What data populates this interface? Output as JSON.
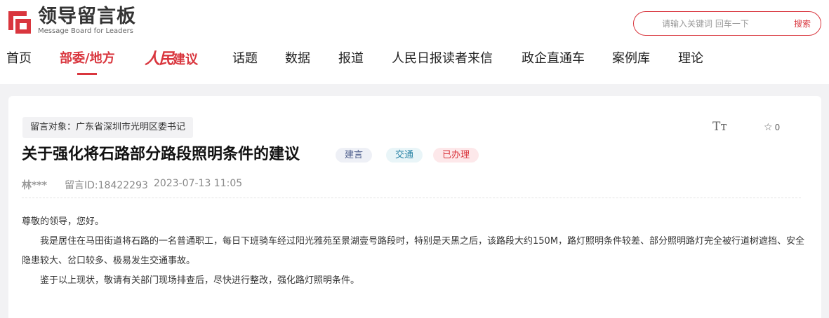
{
  "header": {
    "logo_cn": "领导留言板",
    "logo_en": "Message Board for Leaders",
    "search": {
      "placeholder": "请输入关键词 回车一下",
      "button_label": "搜索"
    }
  },
  "nav": {
    "items": [
      "首页",
      "部委/地方",
      "人民建议",
      "话题",
      "数据",
      "报道",
      "人民日报读者来信",
      "政企直通车",
      "案例库",
      "理论"
    ],
    "brand_script": "人民",
    "brand_rest": "建议",
    "active_index": 1
  },
  "message": {
    "target": "留言对象：广东省深圳市光明区委书记",
    "title": "关于强化将石路部分路段照明条件的建议",
    "tags": [
      "建言",
      "交通",
      "已办理"
    ],
    "author": "林***",
    "id_text": "留言ID:18422293",
    "time": "2023-07-13 11:05",
    "font_icon": "Tт",
    "star_count": "0",
    "paragraphs": [
      "尊敬的领导，您好。",
      "我是居住在马田街道将石路的一名普通职工，每日下班骑车经过阳光雅苑至景湖壹号路段时，特别是天黑之后，该路段大约150M，路灯照明条件较差、部分照明路灯完全被行道树遮挡、安全隐患较大、岔口较多、极易发生交通事故。",
      "鉴于以上现状，敬请有关部门现场排查后，尽快进行整改，强化路灯照明条件。"
    ]
  },
  "colors": {
    "accent": "#d9363e",
    "page_bg": "#f2f2f4"
  }
}
